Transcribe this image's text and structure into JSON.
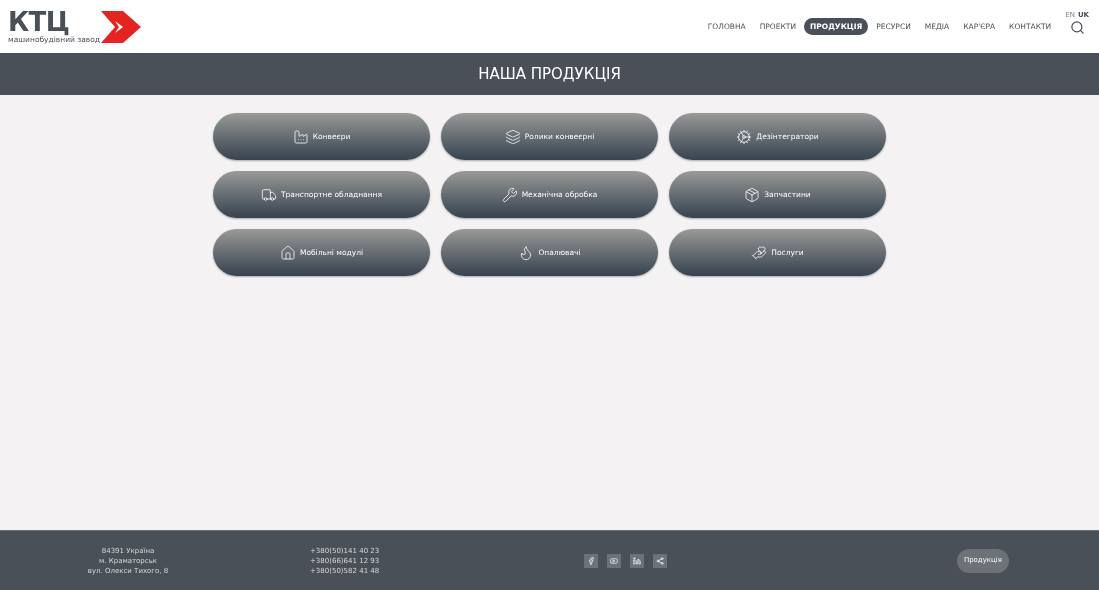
{
  "logo": {
    "text": "КТЦ",
    "tagline": "машинобудівний завод"
  },
  "nav": [
    {
      "label": "ГОЛОВНА",
      "selected": false
    },
    {
      "label": "ПРОЕКТИ",
      "selected": false
    },
    {
      "label": "ПРОДУКЦІЯ",
      "selected": true
    },
    {
      "label": "РЕСУРСИ",
      "selected": false
    },
    {
      "label": "МЕДІА",
      "selected": false
    },
    {
      "label": "КАР'ЄРА",
      "selected": false
    },
    {
      "label": "КОНТАКТИ",
      "selected": false
    }
  ],
  "languages": [
    {
      "label": "EN",
      "selected": false
    },
    {
      "label": "UK",
      "selected": true
    }
  ],
  "page_title": "НАША ПРОДУКЦІЯ",
  "products": [
    {
      "label": "Конвеєри",
      "kind": "conveyor"
    },
    {
      "label": "Ролики конвеєрні",
      "kind": "rollers"
    },
    {
      "label": "Дезінтегратори",
      "kind": "gears"
    },
    {
      "label": "Транспортне обладнання",
      "kind": "transport"
    },
    {
      "label": "Механічна обробка",
      "kind": "machine"
    },
    {
      "label": "Запчастини",
      "kind": "parts"
    },
    {
      "label": "Мобільні модулі",
      "kind": "module"
    },
    {
      "label": "Опалювачі",
      "kind": "heater"
    },
    {
      "label": "Послуги",
      "kind": "service"
    }
  ],
  "footer": {
    "address": [
      "84391 Україна",
      "м. Краматорськ",
      "вул. Олекси Тихого, 8"
    ],
    "phones": [
      "+380(50)141 40 23",
      "+380(66)641 12 93",
      "+380(50)582 41 48"
    ],
    "social": [
      {
        "kind": "facebook"
      },
      {
        "kind": "youtube"
      },
      {
        "kind": "linkedin"
      },
      {
        "kind": "share"
      }
    ],
    "button": "Продукція"
  }
}
